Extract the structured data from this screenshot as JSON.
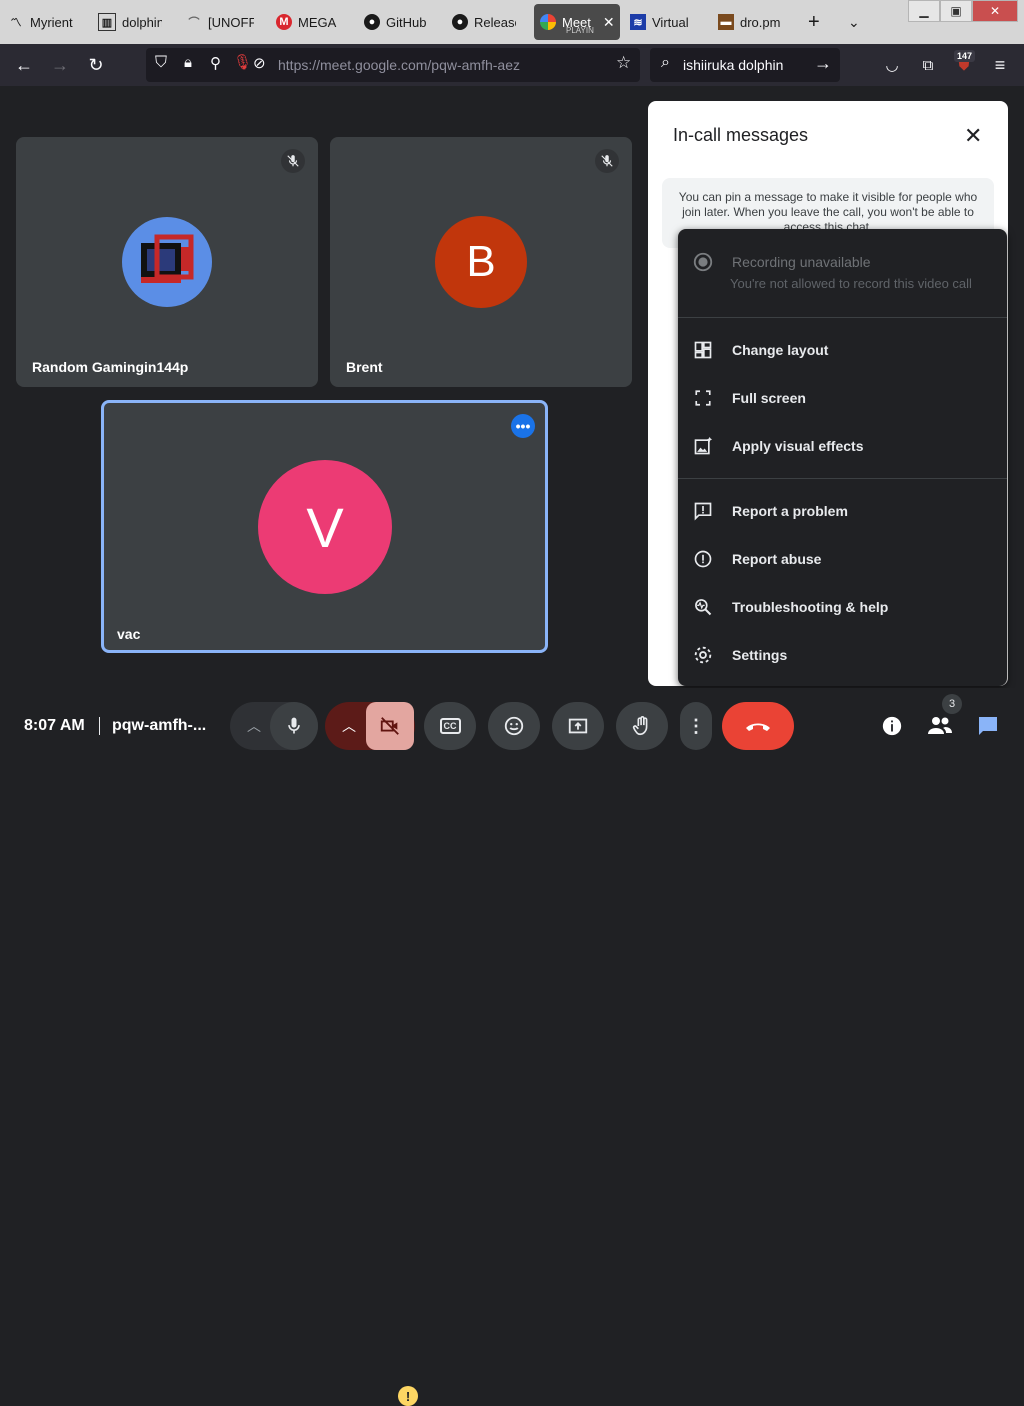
{
  "browser": {
    "tabs": [
      {
        "label": "Myrient",
        "icon": "myrient-icon"
      },
      {
        "label": "dolphin",
        "icon": "dolphin-icon"
      },
      {
        "label": "[UNOFF",
        "icon": "unofficial-icon"
      },
      {
        "label": "MEGA",
        "icon": "mega-icon"
      },
      {
        "label": "GitHub",
        "icon": "github-icon"
      },
      {
        "label": "Release",
        "icon": "github-icon"
      },
      {
        "label": "Meet",
        "sub": "PLAYIN",
        "icon": "meet-icon",
        "active": true
      },
      {
        "label": "Virtual",
        "icon": "virtual-icon"
      },
      {
        "label": "dro.pm",
        "icon": "dropm-icon"
      }
    ],
    "url": "https://meet.google.com/pqw-amfh-aez",
    "search_text": "ishiiruka dolphin",
    "badge_count": "147"
  },
  "participants": [
    {
      "name": "Random Gamingin144p",
      "initial": "",
      "avatar_color": "#5b8ee6",
      "muted": true
    },
    {
      "name": "Brent",
      "initial": "B",
      "avatar_color": "#c1360c",
      "muted": true
    },
    {
      "name": "vac",
      "initial": "V",
      "avatar_color": "#ec3b74",
      "muted": false,
      "highlighted": true
    }
  ],
  "chat_panel": {
    "title": "In-call messages",
    "pin_note": "You can pin a message to make it visible for people who join later. When you leave the call, you won't be able to access this chat."
  },
  "menu": {
    "recording": {
      "label": "Recording unavailable",
      "sub": "You're not allowed to record this video call"
    },
    "items": [
      {
        "label": "Change layout",
        "icon": "layout-icon"
      },
      {
        "label": "Full screen",
        "icon": "fullscreen-icon"
      },
      {
        "label": "Apply visual effects",
        "icon": "visual-effects-icon"
      },
      {
        "label": "Report a problem",
        "icon": "report-problem-icon"
      },
      {
        "label": "Report abuse",
        "icon": "report-abuse-icon"
      },
      {
        "label": "Troubleshooting & help",
        "icon": "troubleshoot-icon"
      },
      {
        "label": "Settings",
        "icon": "settings-icon"
      }
    ]
  },
  "bottom_bar": {
    "time": "8:07 AM",
    "meeting_code": "pqw-amfh-...",
    "people_count": "3",
    "warning_mark": "!",
    "cc_label": "CC"
  },
  "colors": {
    "hangup": "#ea4335",
    "accent": "#8ab4f8",
    "camera_off": "#e3a6a0"
  }
}
